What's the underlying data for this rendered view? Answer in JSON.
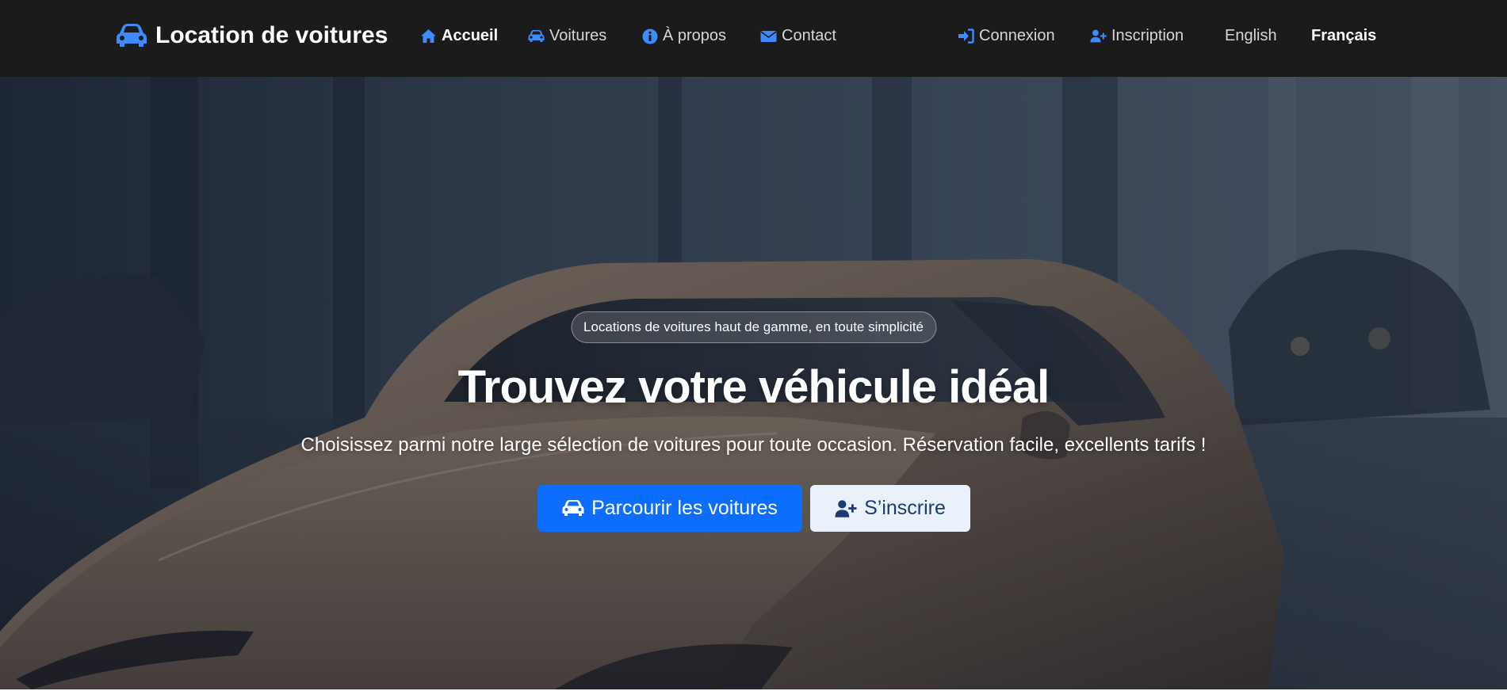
{
  "navbar": {
    "brand": "Location de voitures",
    "links": [
      {
        "label": "Accueil",
        "icon": "home-icon"
      },
      {
        "label": "Voitures",
        "icon": "car-icon"
      },
      {
        "label": "À propos",
        "icon": "info-circle-icon"
      },
      {
        "label": "Contact",
        "icon": "envelope-icon"
      }
    ],
    "auth": [
      {
        "label": "Connexion",
        "icon": "sign-in-icon"
      },
      {
        "label": "Inscription",
        "icon": "user-plus-icon"
      }
    ],
    "languages": [
      "English",
      "Français"
    ],
    "active_language": "Français"
  },
  "hero": {
    "badge": "Locations de voitures haut de gamme, en toute simplicité",
    "title": "Trouvez votre véhicule idéal",
    "subtitle": "Choisissez parmi notre large sélection de voitures pour toute occasion. Réservation facile, excellents tarifs !",
    "primary_button": "Parcourir les voitures",
    "secondary_button": "S’inscrire"
  },
  "colors": {
    "navbar_bg": "#1b1b1b",
    "accent": "#0d6efd",
    "accent_icon": "#3d8bfd",
    "light_button_bg": "#eaf1fb",
    "light_button_text": "#1d3b73"
  }
}
